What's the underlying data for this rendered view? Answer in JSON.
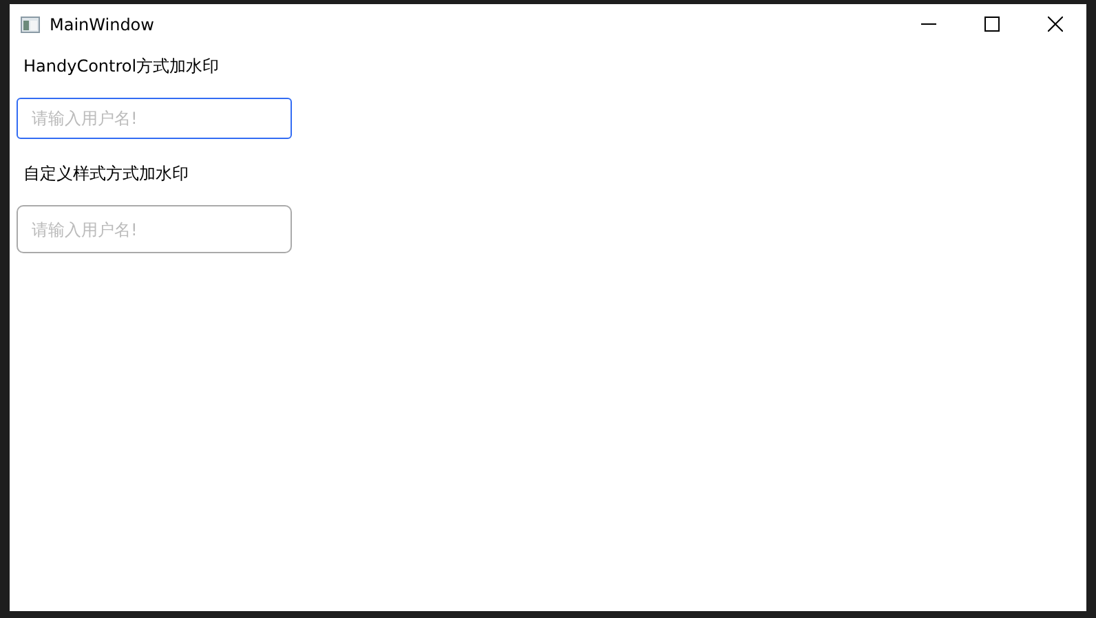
{
  "window": {
    "title": "MainWindow"
  },
  "sections": [
    {
      "kind": "handy",
      "label": "HandyControl方式加水印",
      "field": {
        "placeholder": "请输入用户名!",
        "focused": true
      }
    },
    {
      "kind": "custom",
      "label": "自定义样式方式加水印",
      "field": {
        "placeholder": "请输入用户名!",
        "focused": false
      }
    }
  ]
}
